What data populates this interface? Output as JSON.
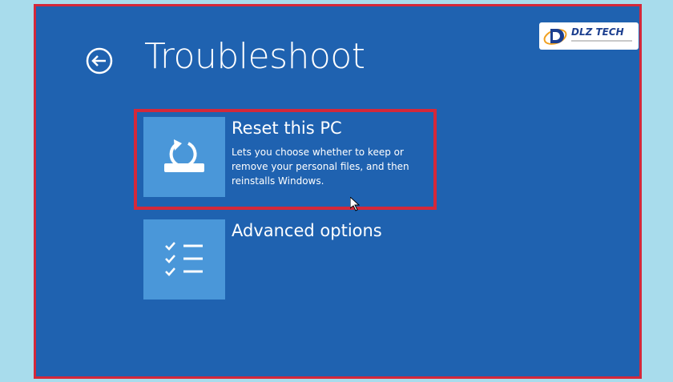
{
  "header": {
    "title": "Troubleshoot",
    "back_icon": "back-arrow-icon"
  },
  "options": [
    {
      "icon": "reset-pc-icon",
      "title": "Reset this PC",
      "description": "Lets you choose whether to keep or remove your personal files, and then reinstalls Windows.",
      "highlighted": true
    },
    {
      "icon": "checklist-icon",
      "title": "Advanced options",
      "description": ""
    }
  ],
  "watermark": {
    "logo_text": "DLZ TECH"
  },
  "colors": {
    "background": "#1f62b0",
    "tile": "#4a97d9",
    "highlight_border": "#d4283a",
    "outer_background": "#a8dcec",
    "text": "#ffffff"
  }
}
